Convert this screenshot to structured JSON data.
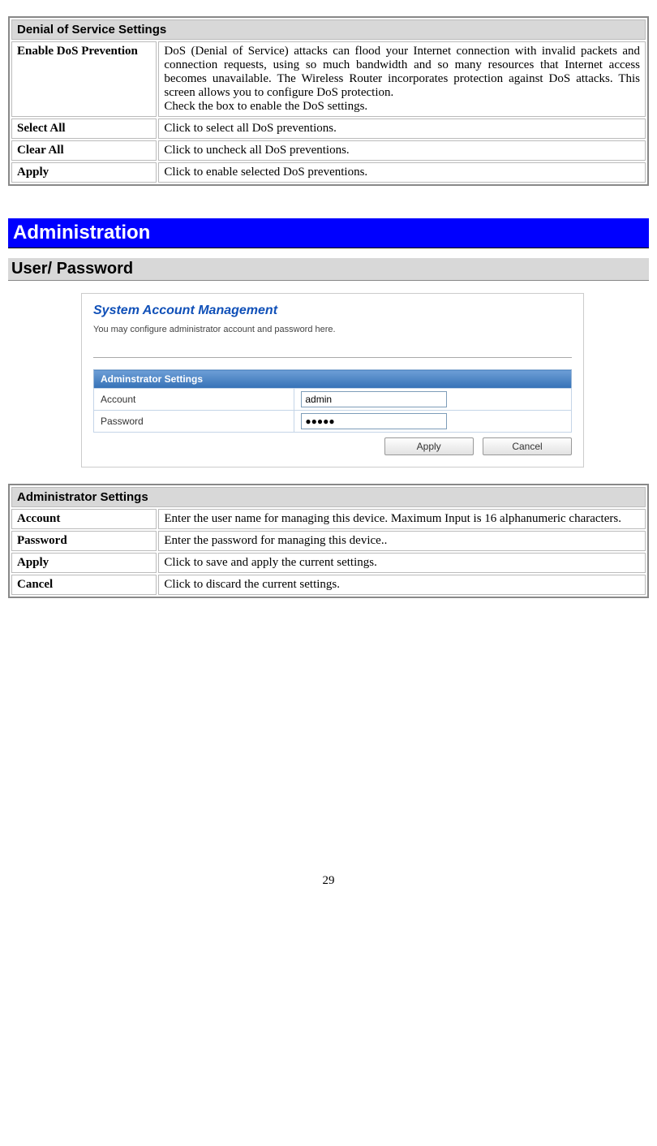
{
  "dos_table": {
    "header": "Denial of Service Settings",
    "rows": [
      {
        "label": "Enable DoS Prevention",
        "desc": "DoS (Denial of Service) attacks can flood your Internet connection with invalid packets and connection requests, using so much bandwidth and so many resources that Internet access becomes unavailable. The Wireless Router incorporates protection against DoS attacks. This screen allows you to configure DoS protection.\nCheck the box to enable the DoS settings."
      },
      {
        "label": "Select All",
        "desc": "Click to select all DoS preventions."
      },
      {
        "label": "Clear All",
        "desc": "Click to uncheck all DoS preventions."
      },
      {
        "label": "Apply",
        "desc": "Click to enable selected DoS preventions."
      }
    ]
  },
  "admin_heading": "Administration",
  "userpass_heading": "User/ Password",
  "screenshot": {
    "title": "System Account Management",
    "desc": "You may configure administrator account and password here.",
    "panel_header": "Adminstrator Settings",
    "account_label": "Account",
    "account_value": "admin",
    "password_label": "Password",
    "password_value": "●●●●●",
    "apply_btn": "Apply",
    "cancel_btn": "Cancel"
  },
  "admin_table": {
    "header": "Administrator Settings",
    "rows": [
      {
        "label": "Account",
        "desc": "Enter the user name for managing this device. Maximum Input is 16 alphanumeric characters."
      },
      {
        "label": "Password",
        "desc": "Enter the password for managing this device.."
      },
      {
        "label": "Apply",
        "desc": "Click to save and apply the current settings."
      },
      {
        "label": "Cancel",
        "desc": "Click to discard the current settings."
      }
    ]
  },
  "page_number": "29"
}
